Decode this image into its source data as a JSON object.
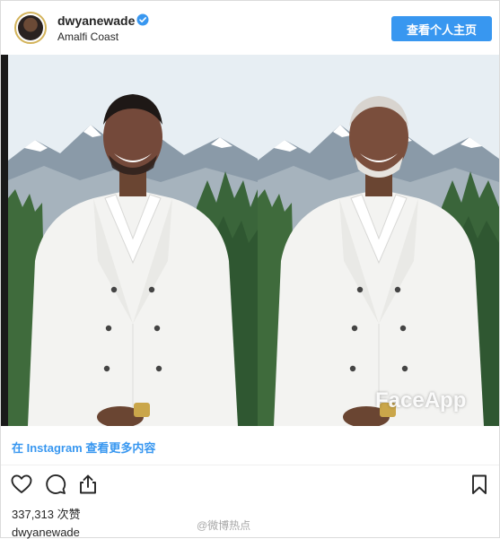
{
  "post": {
    "username": "dwyanewade",
    "location": "Amalfi Coast",
    "profile_button": "查看个人主页",
    "watermark": "FaceApp",
    "instagram_link": "在 Instagram 查看更多内容",
    "likes": "337,313 次赞",
    "caption_username": "dwyanewade"
  },
  "overlay": {
    "source_watermark": "@微博热点"
  },
  "icons": {
    "verified": "verified-badge-icon",
    "like": "heart-icon",
    "comment": "comment-icon",
    "share": "share-icon",
    "save": "bookmark-icon"
  },
  "colors": {
    "accent": "#3897f0",
    "text": "#262626",
    "border": "#dbdbdb",
    "suit": "#f4f4f2",
    "sky": "#e6edf2",
    "trees": "#3d6a3a"
  }
}
